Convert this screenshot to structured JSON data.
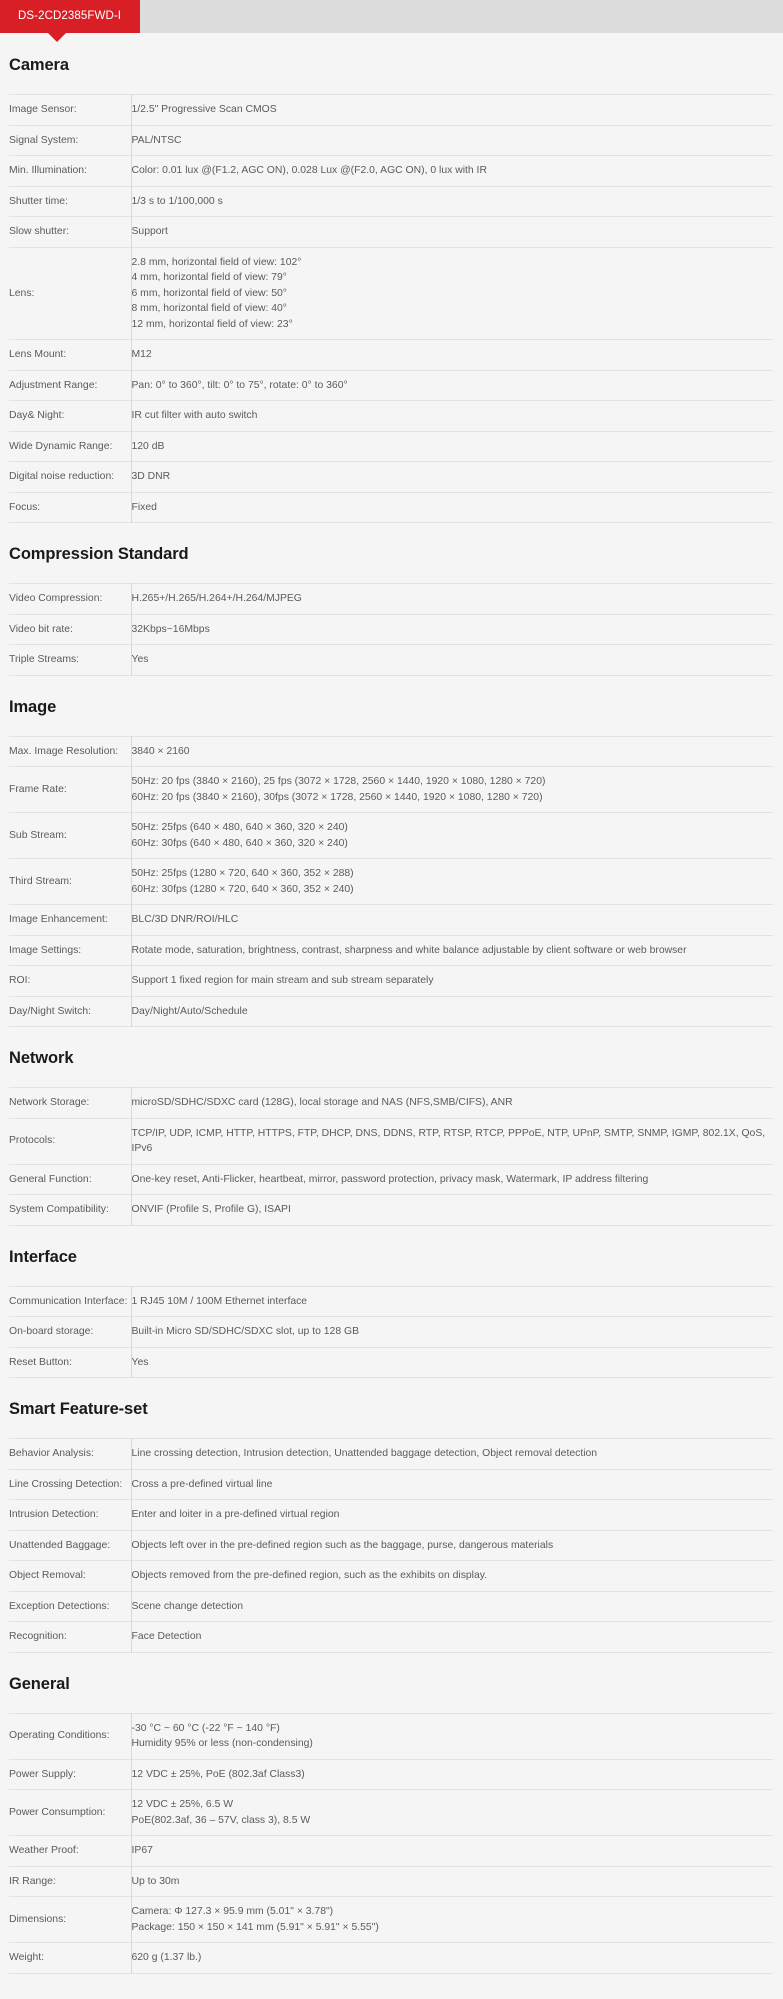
{
  "tab": {
    "label": "DS-2CD2385FWD-I"
  },
  "accent_color": "#d81f26",
  "sections": [
    {
      "title": "Camera",
      "rows": [
        {
          "key": "Image Sensor:",
          "values": [
            "1/2.5\" Progressive Scan CMOS"
          ]
        },
        {
          "key": "Signal System:",
          "values": [
            "PAL/NTSC"
          ]
        },
        {
          "key": "Min. Illumination:",
          "values": [
            "Color: 0.01 lux @(F1.2, AGC ON), 0.028 Lux @(F2.0, AGC ON), 0 lux with IR"
          ]
        },
        {
          "key": "Shutter time:",
          "values": [
            "1/3 s to 1/100,000 s"
          ]
        },
        {
          "key": "Slow shutter:",
          "values": [
            "Support"
          ]
        },
        {
          "key": "Lens:",
          "values": [
            "2.8 mm, horizontal field of view: 102°",
            "4 mm, horizontal field of view: 79°",
            "6 mm, horizontal field of view: 50°",
            "8 mm, horizontal field of view: 40°",
            "12 mm, horizontal field of view: 23°"
          ]
        },
        {
          "key": "Lens Mount:",
          "values": [
            "M12"
          ]
        },
        {
          "key": "Adjustment Range:",
          "values": [
            "Pan: 0° to 360°, tilt: 0° to 75°, rotate: 0° to 360°"
          ]
        },
        {
          "key": "Day& Night:",
          "values": [
            "IR cut filter with auto switch"
          ]
        },
        {
          "key": "Wide Dynamic Range:",
          "values": [
            "120 dB"
          ]
        },
        {
          "key": "Digital noise reduction:",
          "values": [
            "3D DNR"
          ]
        },
        {
          "key": "Focus:",
          "values": [
            "Fixed"
          ]
        }
      ]
    },
    {
      "title": "Compression Standard",
      "rows": [
        {
          "key": "Video Compression:",
          "values": [
            "H.265+/H.265/H.264+/H.264/MJPEG"
          ]
        },
        {
          "key": "Video bit rate:",
          "values": [
            "32Kbps~16Mbps"
          ]
        },
        {
          "key": "Triple Streams:",
          "values": [
            "Yes"
          ]
        }
      ]
    },
    {
      "title": "Image",
      "rows": [
        {
          "key": "Max. Image Resolution:",
          "values": [
            "3840 × 2160"
          ]
        },
        {
          "key": "Frame Rate:",
          "values": [
            "50Hz: 20 fps (3840 × 2160), 25 fps (3072 × 1728, 2560 × 1440, 1920 × 1080, 1280 × 720)",
            "60Hz: 20 fps (3840 × 2160), 30fps (3072 × 1728, 2560 × 1440, 1920 × 1080, 1280 × 720)"
          ]
        },
        {
          "key": "Sub Stream:",
          "values": [
            "50Hz: 25fps (640 × 480, 640 × 360, 320 × 240)",
            "60Hz: 30fps (640 × 480, 640 × 360, 320 × 240)"
          ]
        },
        {
          "key": "Third Stream:",
          "values": [
            "50Hz: 25fps (1280 × 720, 640 × 360, 352 × 288)",
            "60Hz: 30fps (1280 × 720, 640 × 360, 352 × 240)"
          ]
        },
        {
          "key": "Image Enhancement:",
          "values": [
            "BLC/3D DNR/ROI/HLC"
          ]
        },
        {
          "key": "Image Settings:",
          "values": [
            "Rotate mode, saturation, brightness, contrast, sharpness and white balance adjustable by client software or web browser"
          ],
          "wrap": true
        },
        {
          "key": "ROI:",
          "values": [
            "Support 1 fixed region for main stream and sub stream separately"
          ]
        },
        {
          "key": "Day/Night Switch:",
          "values": [
            "Day/Night/Auto/Schedule"
          ]
        }
      ]
    },
    {
      "title": "Network",
      "rows": [
        {
          "key": "Network Storage:",
          "values": [
            "microSD/SDHC/SDXC card (128G), local storage and NAS (NFS,SMB/CIFS), ANR"
          ]
        },
        {
          "key": "Protocols:",
          "values": [
            "TCP/IP, UDP, ICMP, HTTP, HTTPS, FTP, DHCP, DNS, DDNS, RTP, RTSP, RTCP, PPPoE, NTP, UPnP, SMTP, SNMP, IGMP, 802.1X, QoS, IPv6"
          ],
          "wrap": true
        },
        {
          "key": "General Function:",
          "values": [
            "One-key reset, Anti-Flicker, heartbeat, mirror, password protection, privacy mask, Watermark, IP address filtering"
          ],
          "wrap": true
        },
        {
          "key": "System Compatibility:",
          "values": [
            "ONVIF (Profile S, Profile G), ISAPI"
          ]
        }
      ]
    },
    {
      "title": "Interface",
      "rows": [
        {
          "key": "Communication Interface:",
          "values": [
            "1 RJ45 10M / 100M Ethernet interface"
          ],
          "keywrap": true
        },
        {
          "key": "On-board storage:",
          "values": [
            "Built-in Micro SD/SDHC/SDXC slot, up to 128 GB"
          ]
        },
        {
          "key": "Reset Button:",
          "values": [
            "Yes"
          ]
        }
      ]
    },
    {
      "title": "Smart Feature-set",
      "rows": [
        {
          "key": "Behavior Analysis:",
          "values": [
            "Line crossing detection, Intrusion detection, Unattended baggage detection, Object removal detection"
          ]
        },
        {
          "key": "Line Crossing Detection:",
          "values": [
            "Cross a pre-defined virtual line"
          ],
          "keywrap": true
        },
        {
          "key": "Intrusion Detection:",
          "values": [
            "Enter and loiter in a pre-defined virtual region"
          ]
        },
        {
          "key": "Unattended Baggage:",
          "values": [
            "Objects left over in the pre-defined region such as the baggage, purse, dangerous materials"
          ]
        },
        {
          "key": "Object Removal:",
          "values": [
            "Objects removed from the pre-defined region, such as the exhibits on display."
          ]
        },
        {
          "key": "Exception Detections:",
          "values": [
            "Scene change detection"
          ]
        },
        {
          "key": "Recognition:",
          "values": [
            "Face Detection"
          ]
        }
      ]
    },
    {
      "title": "General",
      "rows": [
        {
          "key": "Operating Conditions:",
          "values": [
            "-30 °C ~ 60 °C (-22 °F ~ 140 °F)",
            "Humidity 95% or less (non-condensing)"
          ]
        },
        {
          "key": "Power Supply:",
          "values": [
            "12 VDC ± 25%, PoE (802.3af Class3)"
          ]
        },
        {
          "key": "Power Consumption:",
          "values": [
            "12 VDC ± 25%, 6.5 W",
            "PoE(802.3af, 36 – 57V, class 3), 8.5 W"
          ]
        },
        {
          "key": "Weather Proof:",
          "values": [
            "IP67"
          ]
        },
        {
          "key": "IR Range:",
          "values": [
            "Up to 30m"
          ]
        },
        {
          "key": "Dimensions:",
          "values": [
            "Camera: Φ 127.3 × 95.9 mm (5.01\" × 3.78\")",
            "Package: 150 × 150 × 141 mm (5.91\" × 5.91\" × 5.55\")"
          ]
        },
        {
          "key": "Weight:",
          "values": [
            "620 g (1.37 lb.)"
          ]
        }
      ]
    }
  ]
}
